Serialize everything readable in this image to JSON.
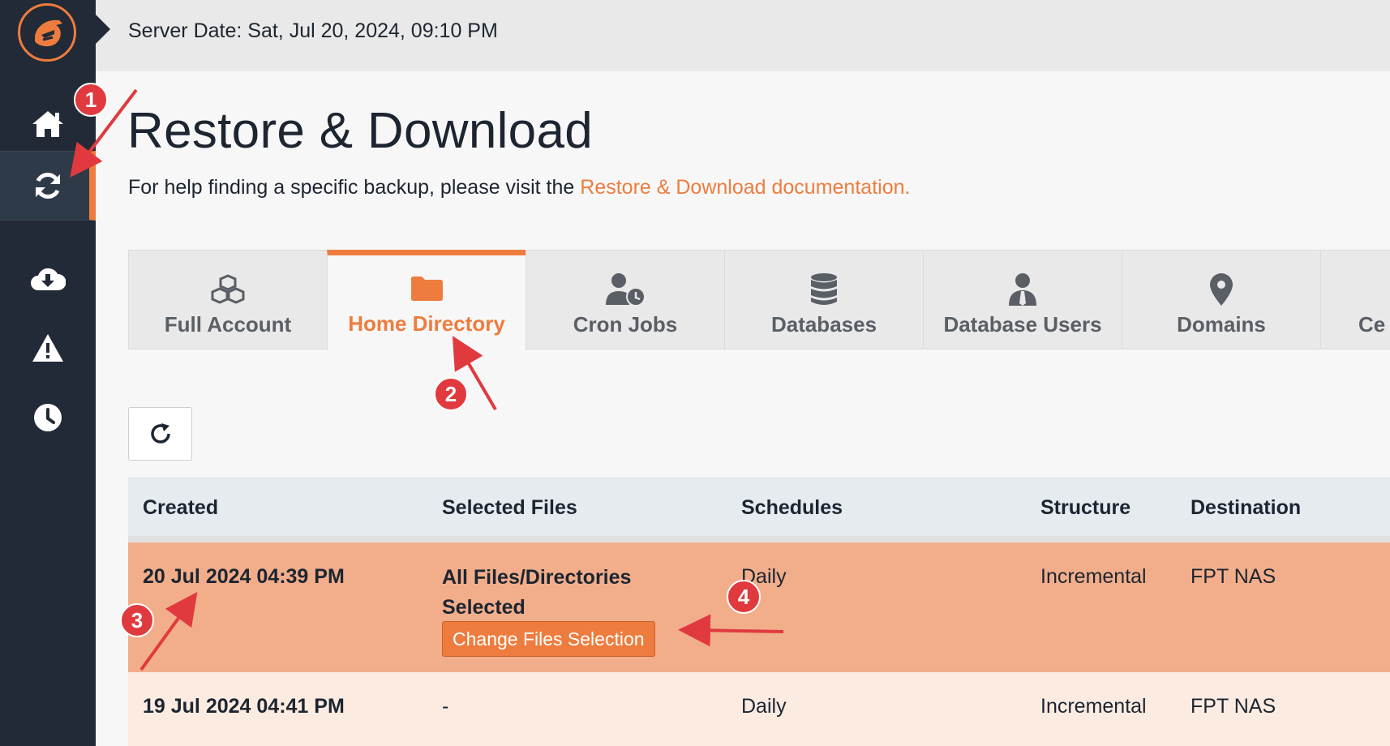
{
  "header": {
    "server_date": "Server Date: Sat, Jul 20, 2024, 09:10 PM"
  },
  "sidebar": {
    "items": [
      {
        "name": "home",
        "icon": "home-icon"
      },
      {
        "name": "restore",
        "icon": "sync-icon",
        "active": true
      },
      {
        "name": "download",
        "icon": "cloud-download-icon"
      },
      {
        "name": "alerts",
        "icon": "warning-icon"
      },
      {
        "name": "history",
        "icon": "clock-icon"
      }
    ]
  },
  "page": {
    "title": "Restore & Download",
    "help_text": "For help finding a specific backup, please visit the ",
    "help_link": "Restore & Download documentation."
  },
  "tabs": [
    {
      "label": "Full Account",
      "icon": "cubes-icon"
    },
    {
      "label": "Home Directory",
      "icon": "folder-icon",
      "active": true
    },
    {
      "label": "Cron Jobs",
      "icon": "user-clock-icon"
    },
    {
      "label": "Databases",
      "icon": "database-icon"
    },
    {
      "label": "Database Users",
      "icon": "user-tie-icon"
    },
    {
      "label": "Domains",
      "icon": "map-marker-icon"
    },
    {
      "label": "Ce",
      "icon": ""
    }
  ],
  "table": {
    "headers": [
      "Created",
      "Selected Files",
      "Schedules",
      "Structure",
      "Destination"
    ],
    "rows": [
      {
        "created": "20 Jul 2024 04:39 PM",
        "selected_files": "All Files/Directories Selected",
        "action": "Change Files Selection",
        "schedules": "Daily",
        "structure": "Incremental",
        "destination": "FPT NAS"
      },
      {
        "created": "19 Jul 2024 04:41 PM",
        "selected_files": "-",
        "schedules": "Daily",
        "structure": "Incremental",
        "destination": "FPT NAS"
      }
    ]
  },
  "annotations": [
    "1",
    "2",
    "3",
    "4"
  ],
  "colors": {
    "accent": "#ee7c3e",
    "sidebar": "#212a36",
    "annotation": "#e03a3e",
    "selected_row": "#f2ae8b"
  }
}
